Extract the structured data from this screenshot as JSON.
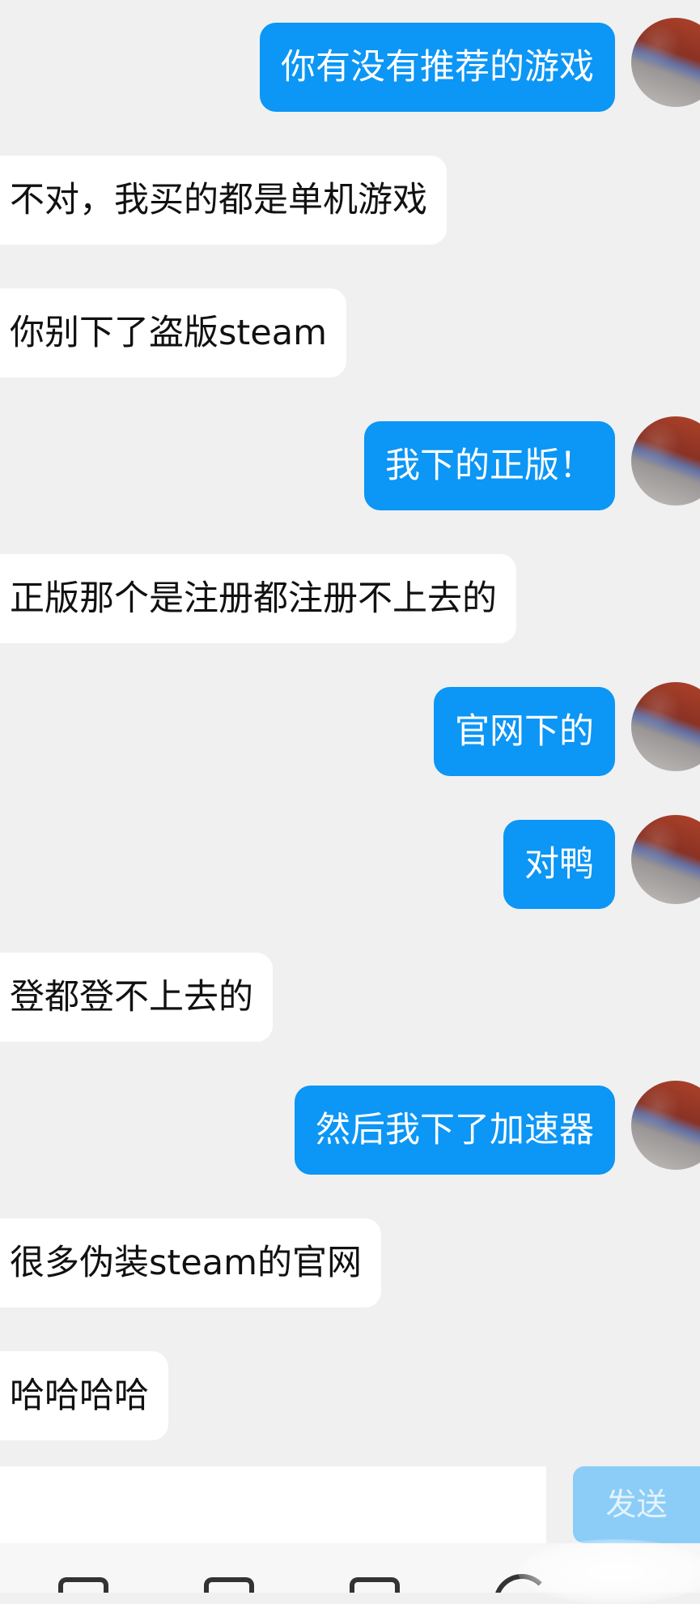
{
  "messages": [
    {
      "side": "out",
      "text": "你有没有推荐的游戏"
    },
    {
      "side": "in",
      "text": "不对，我买的都是单机游戏"
    },
    {
      "side": "in",
      "text": "你别下了盗版steam"
    },
    {
      "side": "out",
      "text": "我下的正版！"
    },
    {
      "side": "in",
      "text": "正版那个是注册都注册不上去的"
    },
    {
      "side": "out",
      "text": "官网下的"
    },
    {
      "side": "out",
      "text": "对鸭"
    },
    {
      "side": "in",
      "text": "登都登不上去的"
    },
    {
      "side": "out",
      "text": "然后我下了加速器"
    },
    {
      "side": "in",
      "text": "很多伪装steam的官网"
    },
    {
      "side": "in",
      "text": "哈哈哈哈"
    }
  ],
  "composer": {
    "value": "",
    "send_label": "发送"
  },
  "colors": {
    "outgoing_bubble": "#0c96f5",
    "incoming_bubble": "#ffffff",
    "background": "#f0f0f0",
    "send_button": "#8ccdf7"
  },
  "icons": [
    "picture-icon",
    "image-icon",
    "mail-icon",
    "emoji-icon"
  ]
}
